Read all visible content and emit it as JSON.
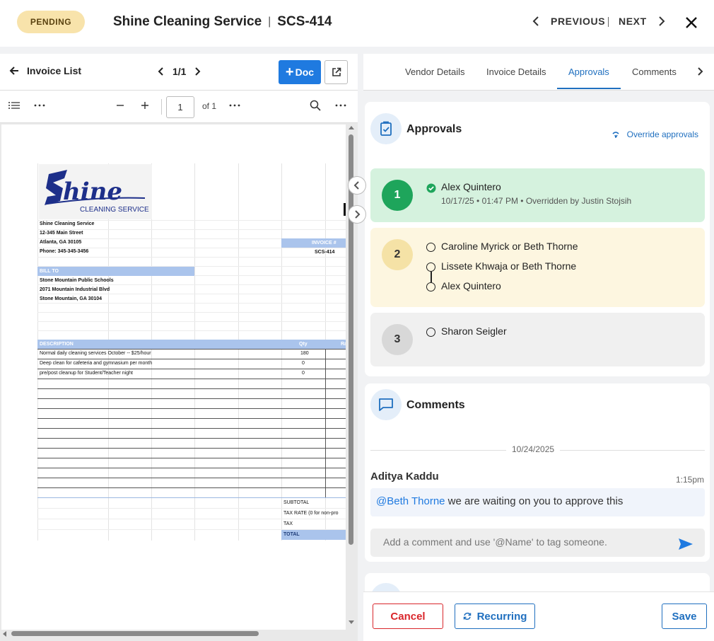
{
  "header": {
    "status": "PENDING",
    "vendor": "Shine Cleaning Service",
    "invoice_id": "SCS-414",
    "previous_label": "PREVIOUS",
    "next_label": "NEXT"
  },
  "viewer": {
    "back_label": "Invoice List",
    "pager": "1/1",
    "doc_button_label": "Doc",
    "page_input": "1",
    "page_of": "of 1"
  },
  "invoice_doc": {
    "company": "Shine Cleaning Service",
    "street": "12-345 Main Street",
    "city": "Atlanta, GA 30105",
    "phone": "Phone: 345-345-3456",
    "invoice_label": "INVOICE #",
    "invoice_no": "SCS-414",
    "bill_to_label": "BILL TO",
    "bill_name": "Stone Mountain Public Schools",
    "bill_street": "2071 Mountain Industrial Blvd",
    "bill_city": "Stone Mountain, GA 30104",
    "desc_header": "DESCRIPTION",
    "qty_header": "Qty",
    "rate_header": "Ra",
    "lines": [
      {
        "desc": "Normal daily cleaning services October -- $25/hour",
        "qty": "180"
      },
      {
        "desc": "Deep clean for cafeteria and gymnasium per month",
        "qty": "0"
      },
      {
        "desc": "pre/post cleanup for Student/Teacher night",
        "qty": "0"
      }
    ],
    "subtotal_label": "SUBTOTAL",
    "tax_rate_label": "TAX RATE (0 for non-pro",
    "tax_label": "TAX",
    "total_label": "TOTAL"
  },
  "tabs": [
    {
      "label": "Vendor Details"
    },
    {
      "label": "Invoice Details"
    },
    {
      "label": "Approvals"
    },
    {
      "label": "Comments"
    }
  ],
  "approvals": {
    "title": "Approvals",
    "override_label": "Override approvals",
    "steps": [
      {
        "number": "1",
        "approvers": [
          "Alex Quintero"
        ],
        "meta": "10/17/25 • 01:47 PM   •   Overridden by Justin Stojsih"
      },
      {
        "number": "2",
        "approvers": [
          "Caroline Myrick or Beth Thorne",
          "Lissete Khwaja or Beth Thorne",
          "Alex Quintero"
        ]
      },
      {
        "number": "3",
        "approvers": [
          "Sharon Seigler"
        ]
      }
    ]
  },
  "comments": {
    "title": "Comments",
    "date": "10/24/2025",
    "author": "Aditya Kaddu",
    "time": "1:15pm",
    "mention": "@Beth Thorne",
    "text": " we are waiting on you to approve this",
    "placeholder": "Add a comment and use '@Name' to tag someone."
  },
  "footer": {
    "cancel_label": "Cancel",
    "recurring_label": "Recurring",
    "save_label": "Save"
  },
  "colors": {
    "accent": "#1f7ae0",
    "approved_green": "#1ea55b",
    "pending_yellow": "#fdf6e0",
    "cancel_red": "#d9262b"
  }
}
